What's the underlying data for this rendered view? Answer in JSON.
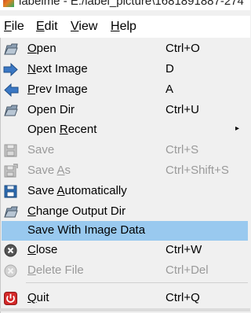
{
  "window": {
    "title": "labelme - E:/label_picture\\1681891887-274"
  },
  "menubar": {
    "file": "File",
    "edit": "Edit",
    "view": "View",
    "help": "Help"
  },
  "file_menu": {
    "items": [
      {
        "label": "Open",
        "shortcut": "Ctrl+O",
        "icon": "folder-open-icon",
        "enabled": true
      },
      {
        "label": "Next Image",
        "shortcut": "D",
        "icon": "arrow-right-icon",
        "enabled": true
      },
      {
        "label": "Prev Image",
        "shortcut": "A",
        "icon": "arrow-left-icon",
        "enabled": true
      },
      {
        "label": "Open Dir",
        "shortcut": "Ctrl+U",
        "icon": "folder-open-icon",
        "enabled": true
      },
      {
        "label": "Open Recent",
        "shortcut": "",
        "icon": "",
        "enabled": true,
        "submenu": true
      },
      {
        "label": "Save",
        "shortcut": "Ctrl+S",
        "icon": "floppy-disk-icon",
        "enabled": false
      },
      {
        "label": "Save As",
        "shortcut": "Ctrl+Shift+S",
        "icon": "floppy-disk-as-icon",
        "enabled": false
      },
      {
        "label": "Save Automatically",
        "shortcut": "",
        "icon": "floppy-disk-icon",
        "enabled": true
      },
      {
        "label": "Change Output Dir",
        "shortcut": "",
        "icon": "folder-open-icon",
        "enabled": true
      },
      {
        "label": "Save With Image Data",
        "shortcut": "",
        "icon": "",
        "enabled": true,
        "highlighted": true
      },
      {
        "label": "Close",
        "shortcut": "Ctrl+W",
        "icon": "close-circle-icon",
        "enabled": true
      },
      {
        "label": "Delete File",
        "shortcut": "Ctrl+Del",
        "icon": "close-circle-icon",
        "enabled": false
      },
      {
        "label": "Quit",
        "shortcut": "Ctrl+Q",
        "icon": "power-icon",
        "enabled": true
      }
    ],
    "submenu_arrow": "▸"
  },
  "colors": {
    "highlight": "#99c9ef",
    "disabled_text": "#9a9a9a"
  }
}
